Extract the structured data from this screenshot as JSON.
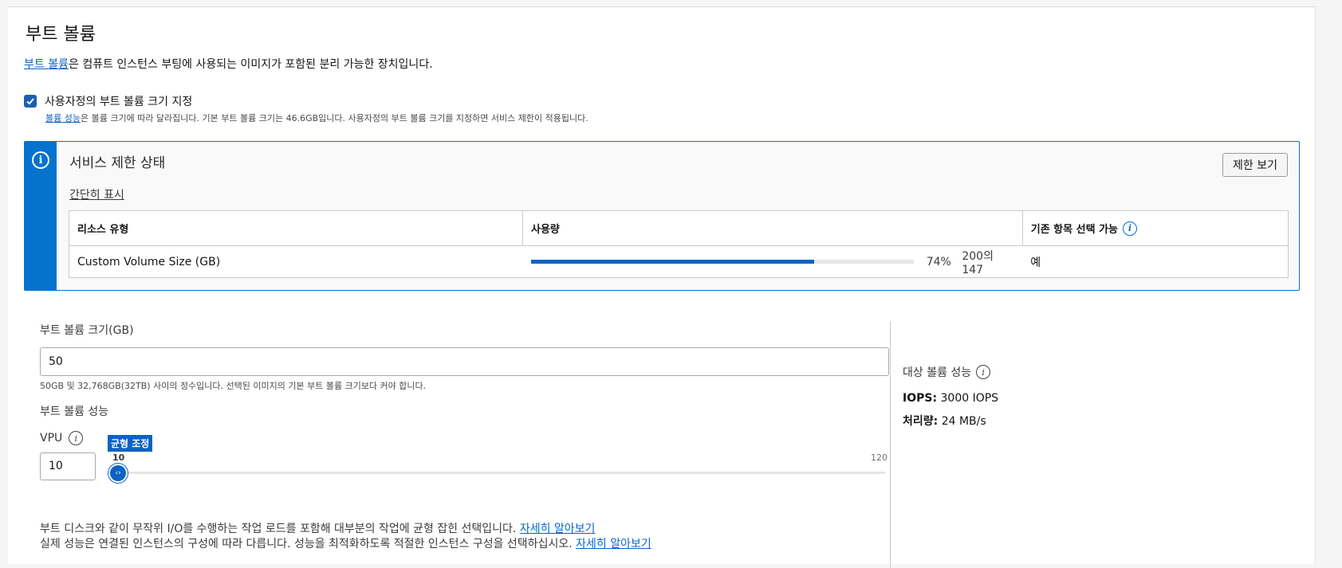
{
  "section": {
    "title": "부트 볼륨",
    "intro_link": "부트 볼륨",
    "intro_text": "은 컴퓨트 인스턴스 부팅에 사용되는 이미지가 포함된 분리 가능한 장치입니다."
  },
  "custom_size": {
    "checked": true,
    "label": "사용자정의 부트 볼륨 크기 지정",
    "help_link": "볼륨 성능",
    "help_text": "은 볼륨 크기에 따라 달라집니다. 기본 부트 볼륨 크기는 46.6GB입니다. 사용자정의 부트 볼륨 크기를 지정하면 서비스 제한이 적용됩니다."
  },
  "limits": {
    "title": "서비스 제한 상태",
    "toggle": "간단히 표시",
    "view_button": "제한 보기",
    "columns": [
      "리소스 유형",
      "사용량",
      "기존 항목 선택 가능"
    ],
    "rows": [
      {
        "resource": "Custom Volume Size (GB)",
        "usage_fraction": 0.74,
        "percent": "74%",
        "used": "200의 147",
        "available": "예"
      }
    ]
  },
  "boot_size": {
    "label": "부트 볼륨 크기(GB)",
    "value": "50",
    "hint": "50GB 및 32,768GB(32TB) 사이의 정수입니다. 선택된 이미지의 기본 부트 볼륨 크기보다 커야 합니다."
  },
  "performance": {
    "label": "부트 볼륨 성능",
    "vpu_label": "VPU",
    "vpu_value": "10",
    "slider_tag": "균형 조정",
    "slider_min": "10",
    "slider_max": "120",
    "slider_value": 10,
    "note1_text": "부트 디스크와 같이 무작위 I/O를 수행하는 작업 로드를 포함해 대부분의 작업에 균형 잡힌 선택입니다. ",
    "note1_link": "자세히 알아보기",
    "note2_text": "실제 성능은 연결된 인스턴스의 구성에 따라 다릅니다. 성능을 최적화하도록 적절한 인스턴스 구성을 선택하십시오. ",
    "note2_link": "자세히 알아보기"
  },
  "target": {
    "title": "대상 볼륨 성능",
    "iops_label": "IOPS:",
    "iops_value": " 3000 IOPS",
    "throughput_label": "처리량:",
    "throughput_value": " 24 MB/s"
  },
  "colors": {
    "accent": "#0572ce",
    "link": "#0b63c4",
    "progress": "#0b63c4"
  }
}
